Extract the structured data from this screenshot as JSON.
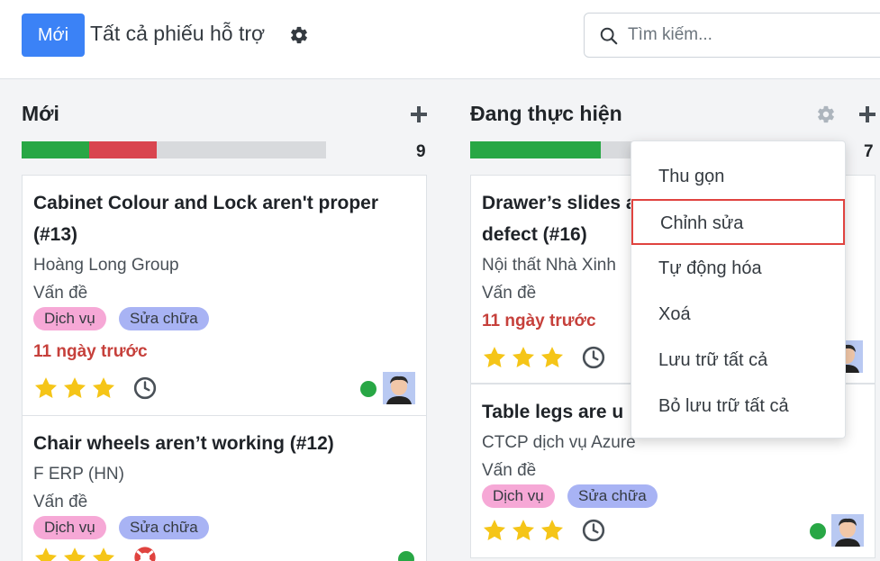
{
  "header": {
    "new_button": "Mới",
    "title": "Tất cả phiếu hỗ trợ",
    "search_placeholder": "Tìm kiếm..."
  },
  "columns": [
    {
      "title": "Mới",
      "count": "9",
      "progress": [
        {
          "color": "#28a745",
          "fraction": 0.22
        },
        {
          "color": "#d9454f",
          "fraction": 0.22
        }
      ],
      "cards": [
        {
          "title_line1": "Cabinet Colour and Lock aren't proper",
          "title_line2": "(#13)",
          "customer": "Hoàng Long Group",
          "type": "Vấn đề",
          "tags": [
            "Dịch vụ",
            "Sửa chữa"
          ],
          "date": "11 ngày trước",
          "stars": 3
        },
        {
          "title_line1": "Chair wheels aren’t working (#12)",
          "customer": "F ERP (HN)",
          "type": "Vấn đề",
          "tags": [
            "Dịch vụ",
            "Sửa chữa"
          ],
          "stars": 3
        }
      ]
    },
    {
      "title": "Đang thực hiện",
      "count": "7",
      "progress": [
        {
          "color": "#28a745",
          "fraction": 0.6
        }
      ],
      "cards": [
        {
          "title_line1": "Drawer’s slides a",
          "title_line2": "defect (#16)",
          "customer": "Nội thất Nhà Xinh",
          "type": "Vấn đề",
          "date": "11 ngày trước",
          "stars": 3
        },
        {
          "title_line1": "Table legs are u",
          "customer": "CTCP dịch vụ Azure",
          "type": "Vấn đề",
          "tags": [
            "Dịch vụ",
            "Sửa chữa"
          ],
          "stars": 3
        }
      ]
    }
  ],
  "dropdown": {
    "items": [
      "Thu gọn",
      "Chỉnh sửa",
      "Tự động hóa",
      "Xoá",
      "Lưu trữ tất cả",
      "Bỏ lưu trữ tất cả"
    ],
    "highlighted": "Chỉnh sửa"
  },
  "colors": {
    "primary": "#3b82f6",
    "star": "#f5c518",
    "overdue": "#c6403b",
    "online": "#28a745",
    "tag_pink": "#f6a8d6",
    "tag_blue": "#a8b3f4",
    "highlight_border": "#e0433f"
  },
  "icons": {
    "gear": "gear-icon",
    "search": "search-icon",
    "plus": "plus-icon",
    "star": "star-icon",
    "clock": "clock-icon",
    "life_ring": "life-ring-icon"
  }
}
